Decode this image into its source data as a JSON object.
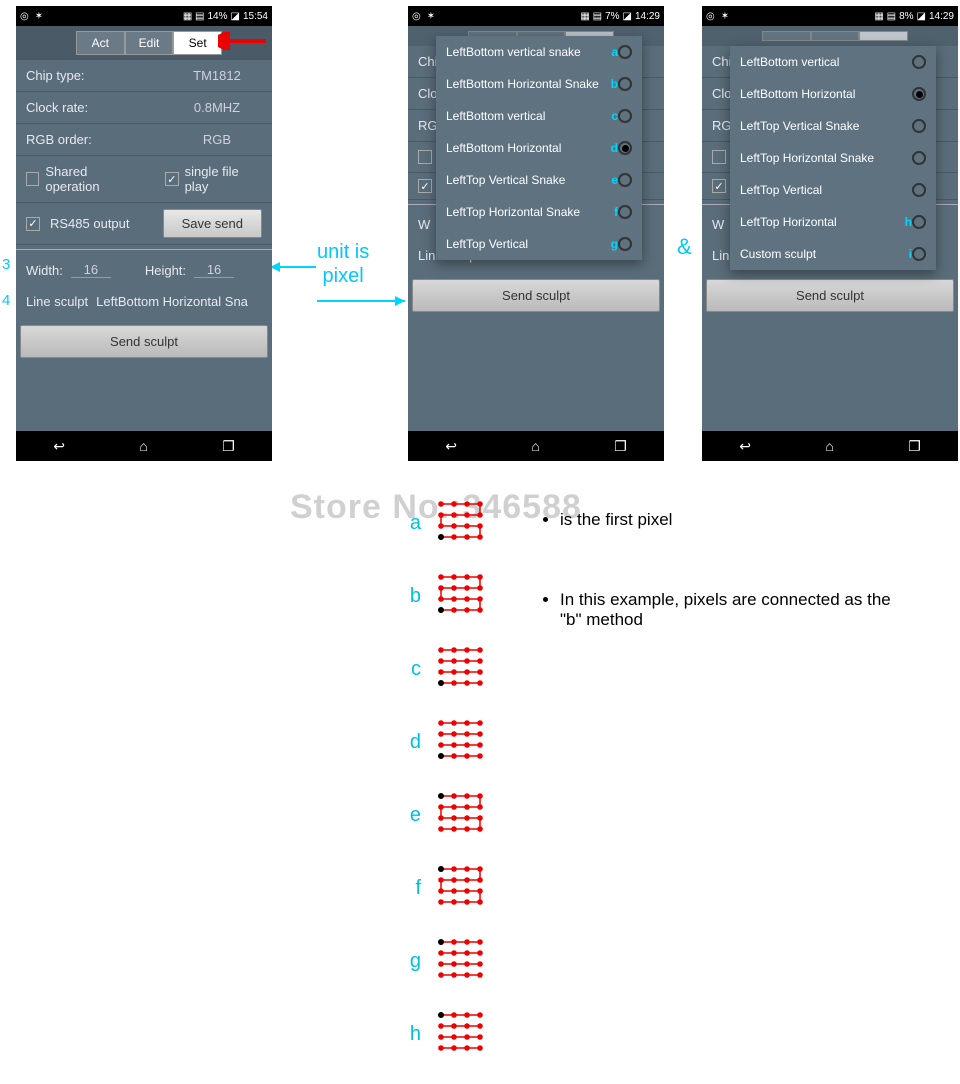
{
  "statusbar1": {
    "battery": "14%",
    "time": "15:54"
  },
  "statusbar2": {
    "battery": "7%",
    "time": "14:29"
  },
  "statusbar3": {
    "battery": "8%",
    "time": "14:29"
  },
  "tabs": {
    "act": "Act",
    "edit": "Edit",
    "set": "Set"
  },
  "settings": {
    "chip_label": "Chip type:",
    "chip_value": "TM1812",
    "clock_label": "Clock rate:",
    "clock_value": "0.8MHZ",
    "rgb_label": "RGB order:",
    "rgb_value": "RGB",
    "shared_label": "Shared operation",
    "single_label": "single file play",
    "rs485_label": "RS485 output",
    "save_btn": "Save send",
    "width_label": "Width:",
    "width_value": "16",
    "height_label": "Height:",
    "height_value": "16",
    "line_label": "Line sculpt",
    "line_value1": "LeftBottom Horizontal Sna",
    "line_value23": "LeftBottom Horizontal",
    "send_btn": "Send sculpt"
  },
  "dropdown1": [
    {
      "text": "LeftBottom vertical snake",
      "letter": "a",
      "selected": false
    },
    {
      "text": "LeftBottom Horizontal Snake",
      "letter": "b",
      "selected": false
    },
    {
      "text": "LeftBottom vertical",
      "letter": "c",
      "selected": false
    },
    {
      "text": "LeftBottom Horizontal",
      "letter": "d",
      "selected": true
    },
    {
      "text": "LeftTop Vertical Snake",
      "letter": "e",
      "selected": false
    },
    {
      "text": "LeftTop Horizontal Snake",
      "letter": "f",
      "selected": false
    },
    {
      "text": "LeftTop Vertical",
      "letter": "g",
      "selected": false
    }
  ],
  "dropdown2": [
    {
      "text": "LeftBottom vertical",
      "letter": "",
      "selected": false
    },
    {
      "text": "LeftBottom Horizontal",
      "letter": "",
      "selected": true
    },
    {
      "text": "LeftTop Vertical Snake",
      "letter": "",
      "selected": false
    },
    {
      "text": "LeftTop Horizontal Snake",
      "letter": "",
      "selected": false
    },
    {
      "text": "LeftTop Vertical",
      "letter": "",
      "selected": false
    },
    {
      "text": "LeftTop Horizontal",
      "letter": "h",
      "selected": false
    },
    {
      "text": "Custom sculpt",
      "letter": "i",
      "selected": false
    }
  ],
  "watermark": "Store No.:346588",
  "annotations": {
    "unit": "unit is\npixel",
    "amp": "&",
    "n3": "3",
    "n4": "4"
  },
  "legend": {
    "item1": "is the first pixel",
    "item2": "In this example, pixels are connected as the \"b\" method"
  },
  "diagram_letters": [
    "a",
    "b",
    "c",
    "d",
    "e",
    "f",
    "g",
    "h"
  ]
}
